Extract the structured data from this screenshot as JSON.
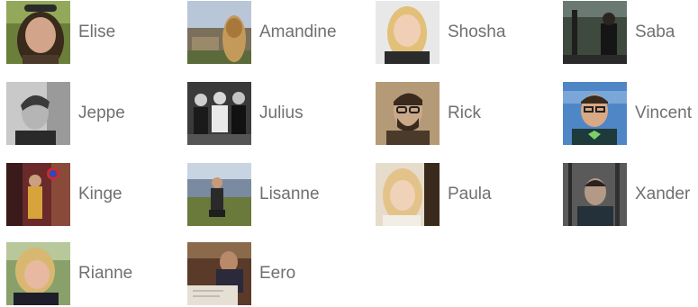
{
  "team": {
    "members": [
      {
        "name": "Elise",
        "photo": "portrait-dark-hair-outdoor-photo"
      },
      {
        "name": "Amandine",
        "photo": "portrait-city-view-photo"
      },
      {
        "name": "Shosha",
        "photo": "portrait-blonde-smiling-photo"
      },
      {
        "name": "Saba",
        "photo": "portrait-dark-street-photo"
      },
      {
        "name": "Jeppe",
        "photo": "portrait-black-white-man-photo"
      },
      {
        "name": "Julius",
        "photo": "portrait-black-white-group-photo"
      },
      {
        "name": "Rick",
        "photo": "portrait-sepia-glasses-photo"
      },
      {
        "name": "Vincent",
        "photo": "portrait-glasses-blue-background-photo"
      },
      {
        "name": "Kinge",
        "photo": "portrait-street-yellow-coat-photo"
      },
      {
        "name": "Lisanne",
        "photo": "portrait-landscape-hiking-photo"
      },
      {
        "name": "Paula",
        "photo": "portrait-blonde-warm-photo"
      },
      {
        "name": "Xander",
        "photo": "portrait-dark-forest-photo"
      },
      {
        "name": "Rianne",
        "photo": "portrait-laughing-blonde-photo"
      },
      {
        "name": "Eero",
        "photo": "portrait-desk-working-photo"
      }
    ]
  }
}
